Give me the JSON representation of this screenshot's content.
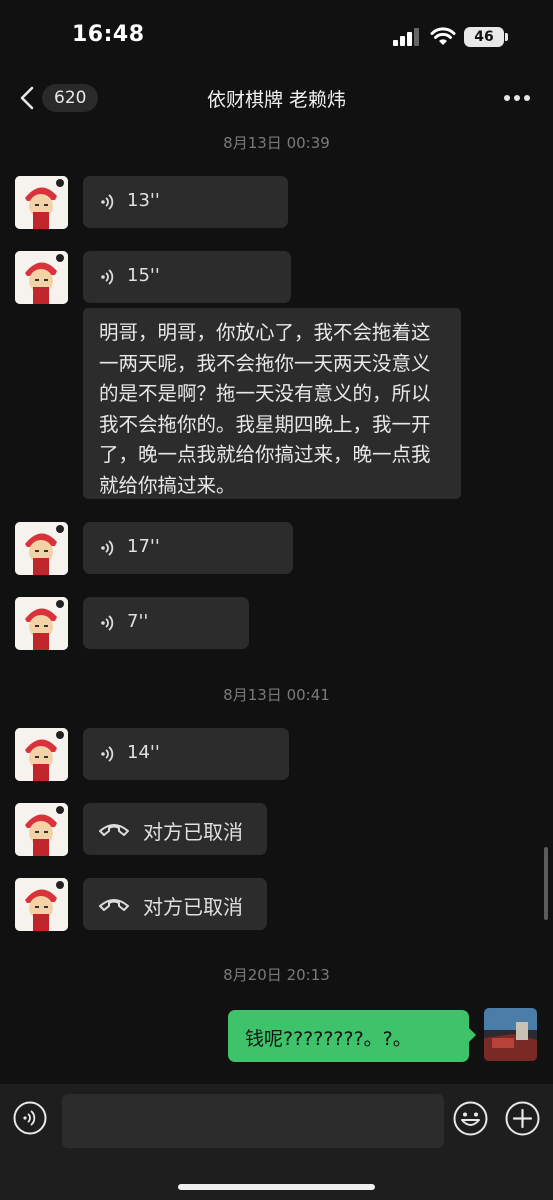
{
  "status": {
    "time": "16:48",
    "battery": "46"
  },
  "nav": {
    "unread_count": "620",
    "title": "依财棋牌 老赖炜"
  },
  "messages": {
    "ts1": "8月13日 00:39",
    "v1": "13''",
    "v2": "15''",
    "transcript": "明哥，明哥，你放心了，我不会拖着这一两天呢，我不会拖你一天两天没意义的是不是啊？拖一天没有意义的，所以我不会拖你的。我星期四晚上，我一开了，晚一点我就给你搞过来，晚一点我就给你搞过来。",
    "v3": "17''",
    "v4": "7''",
    "ts2": "8月13日 00:41",
    "v5": "14''",
    "call1": "对方已取消",
    "call2": "对方已取消",
    "ts3": "8月20日 20:13",
    "mine": "钱呢????????。?。"
  },
  "colors": {
    "accent_green": "#3ec26a",
    "bubble_dark": "#2c2c2c",
    "background": "#111111"
  }
}
